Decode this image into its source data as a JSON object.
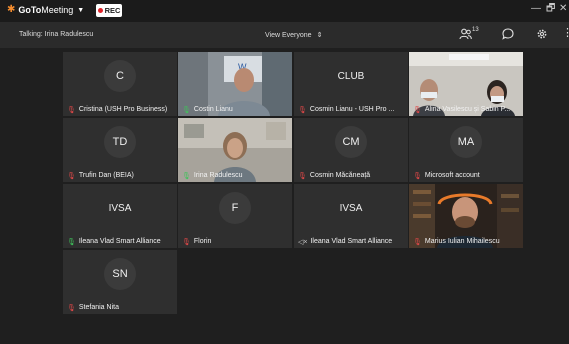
{
  "titlebar": {
    "app_name_bold": "GoTo",
    "app_name_rest": "Meeting",
    "rec_label": "REC",
    "minimize": "—",
    "restore": "🗗",
    "close": "✕"
  },
  "toolbar": {
    "talking": "Talking: Irina Radulescu",
    "view": "View Everyone",
    "participants_count": "13"
  },
  "tiles": [
    {
      "initials": "C",
      "name": "Cristina (USH Pro Business)",
      "mic": "muted"
    },
    {
      "initials": "",
      "name": "Costin Lianu",
      "mic": "on"
    },
    {
      "initials": "CLUB",
      "name": "Cosmin Lianu - USH Pro ...",
      "mic": "muted"
    },
    {
      "initials": "",
      "name": "Alina Vasilescu și Sabin P...",
      "mic": "muted"
    },
    {
      "initials": "TD",
      "name": "Trufin Dan (BEIA)",
      "mic": "muted"
    },
    {
      "initials": "",
      "name": "Irina Radulescu",
      "mic": "on"
    },
    {
      "initials": "CM",
      "name": "Cosmin Măcăneață",
      "mic": "muted"
    },
    {
      "initials": "MA",
      "name": "Microsoft account",
      "mic": "muted"
    },
    {
      "initials": "IVSA",
      "name": "Ileana Vlad Smart Alliance",
      "mic": "on"
    },
    {
      "initials": "F",
      "name": "Florin",
      "mic": "muted"
    },
    {
      "initials": "IVSA",
      "name": "Ileana Vlad Smart Alliance",
      "mic": "other"
    },
    {
      "initials": "",
      "name": "Marius Iulian Mihailescu",
      "mic": "muted"
    },
    {
      "initials": "SN",
      "name": "Stefania Nita",
      "mic": "muted"
    }
  ]
}
